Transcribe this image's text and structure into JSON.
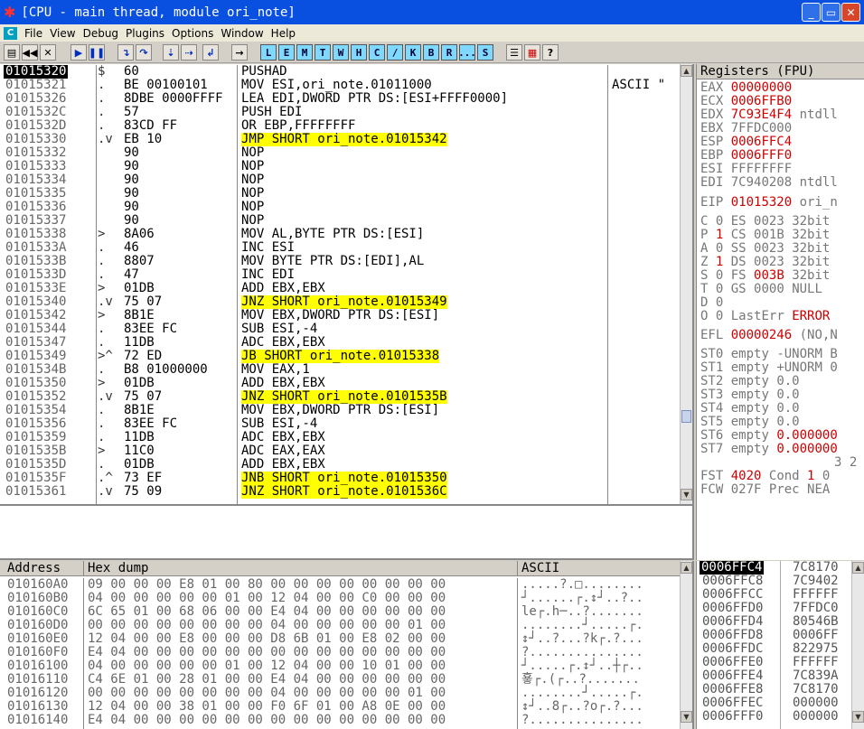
{
  "window": {
    "title": "[CPU - main thread, module ori_note]"
  },
  "menu": [
    "File",
    "View",
    "Debug",
    "Plugins",
    "Options",
    "Window",
    "Help"
  ],
  "toolbar": {
    "letters": [
      "L",
      "E",
      "M",
      "T",
      "W",
      "H",
      "C",
      "/",
      "K",
      "B",
      "R",
      "...",
      "S"
    ]
  },
  "disasm": {
    "rows": [
      {
        "addr": "01015320",
        "mark": "$",
        "hex": "60",
        "instr": "PUSHAD",
        "comment": "",
        "sel": true,
        "hl": false
      },
      {
        "addr": "01015321",
        "mark": ".",
        "hex": "BE 00100101",
        "instr": "MOV ESI,ori_note.01011000",
        "comment": "ASCII \"",
        "sel": false,
        "hl": false
      },
      {
        "addr": "01015326",
        "mark": ".",
        "hex": "8DBE 0000FFFF",
        "instr": "LEA EDI,DWORD PTR DS:[ESI+FFFF0000]",
        "comment": "",
        "sel": false,
        "hl": false
      },
      {
        "addr": "0101532C",
        "mark": ".",
        "hex": "57",
        "instr": "PUSH EDI",
        "comment": "",
        "sel": false,
        "hl": false
      },
      {
        "addr": "0101532D",
        "mark": ".",
        "hex": "83CD FF",
        "instr": "OR EBP,FFFFFFFF",
        "comment": "",
        "sel": false,
        "hl": false
      },
      {
        "addr": "01015330",
        "mark": ".v",
        "hex": "EB 10",
        "instr": "JMP SHORT ori_note.01015342",
        "comment": "",
        "sel": false,
        "hl": true
      },
      {
        "addr": "01015332",
        "mark": "",
        "hex": "90",
        "instr": "NOP",
        "comment": "",
        "sel": false,
        "hl": false
      },
      {
        "addr": "01015333",
        "mark": "",
        "hex": "90",
        "instr": "NOP",
        "comment": "",
        "sel": false,
        "hl": false
      },
      {
        "addr": "01015334",
        "mark": "",
        "hex": "90",
        "instr": "NOP",
        "comment": "",
        "sel": false,
        "hl": false
      },
      {
        "addr": "01015335",
        "mark": "",
        "hex": "90",
        "instr": "NOP",
        "comment": "",
        "sel": false,
        "hl": false
      },
      {
        "addr": "01015336",
        "mark": "",
        "hex": "90",
        "instr": "NOP",
        "comment": "",
        "sel": false,
        "hl": false
      },
      {
        "addr": "01015337",
        "mark": "",
        "hex": "90",
        "instr": "NOP",
        "comment": "",
        "sel": false,
        "hl": false
      },
      {
        "addr": "01015338",
        "mark": ">",
        "hex": "8A06",
        "instr": "MOV AL,BYTE PTR DS:[ESI]",
        "comment": "",
        "sel": false,
        "hl": false
      },
      {
        "addr": "0101533A",
        "mark": ".",
        "hex": "46",
        "instr": "INC ESI",
        "comment": "",
        "sel": false,
        "hl": false
      },
      {
        "addr": "0101533B",
        "mark": ".",
        "hex": "8807",
        "instr": "MOV BYTE PTR DS:[EDI],AL",
        "comment": "",
        "sel": false,
        "hl": false
      },
      {
        "addr": "0101533D",
        "mark": ".",
        "hex": "47",
        "instr": "INC EDI",
        "comment": "",
        "sel": false,
        "hl": false
      },
      {
        "addr": "0101533E",
        "mark": ">",
        "hex": "01DB",
        "instr": "ADD EBX,EBX",
        "comment": "",
        "sel": false,
        "hl": false
      },
      {
        "addr": "01015340",
        "mark": ".v",
        "hex": "75 07",
        "instr": "JNZ SHORT ori_note.01015349",
        "comment": "",
        "sel": false,
        "hl": true
      },
      {
        "addr": "01015342",
        "mark": ">",
        "hex": "8B1E",
        "instr": "MOV EBX,DWORD PTR DS:[ESI]",
        "comment": "",
        "sel": false,
        "hl": false
      },
      {
        "addr": "01015344",
        "mark": ".",
        "hex": "83EE FC",
        "instr": "SUB ESI,-4",
        "comment": "",
        "sel": false,
        "hl": false
      },
      {
        "addr": "01015347",
        "mark": ".",
        "hex": "11DB",
        "instr": "ADC EBX,EBX",
        "comment": "",
        "sel": false,
        "hl": false
      },
      {
        "addr": "01015349",
        "mark": ">^",
        "hex": "72 ED",
        "instr": "JB SHORT ori_note.01015338",
        "comment": "",
        "sel": false,
        "hl": true
      },
      {
        "addr": "0101534B",
        "mark": ".",
        "hex": "B8 01000000",
        "instr": "MOV EAX,1",
        "comment": "",
        "sel": false,
        "hl": false
      },
      {
        "addr": "01015350",
        "mark": ">",
        "hex": "01DB",
        "instr": "ADD EBX,EBX",
        "comment": "",
        "sel": false,
        "hl": false
      },
      {
        "addr": "01015352",
        "mark": ".v",
        "hex": "75 07",
        "instr": "JNZ SHORT ori_note.0101535B",
        "comment": "",
        "sel": false,
        "hl": true
      },
      {
        "addr": "01015354",
        "mark": ".",
        "hex": "8B1E",
        "instr": "MOV EBX,DWORD PTR DS:[ESI]",
        "comment": "",
        "sel": false,
        "hl": false
      },
      {
        "addr": "01015356",
        "mark": ".",
        "hex": "83EE FC",
        "instr": "SUB ESI,-4",
        "comment": "",
        "sel": false,
        "hl": false
      },
      {
        "addr": "01015359",
        "mark": ".",
        "hex": "11DB",
        "instr": "ADC EBX,EBX",
        "comment": "",
        "sel": false,
        "hl": false
      },
      {
        "addr": "0101535B",
        "mark": ">",
        "hex": "11C0",
        "instr": "ADC EAX,EAX",
        "comment": "",
        "sel": false,
        "hl": false
      },
      {
        "addr": "0101535D",
        "mark": ".",
        "hex": "01DB",
        "instr": "ADD EBX,EBX",
        "comment": "",
        "sel": false,
        "hl": false
      },
      {
        "addr": "0101535F",
        "mark": ".^",
        "hex": "73 EF",
        "instr": "JNB SHORT ori_note.01015350",
        "comment": "",
        "sel": false,
        "hl": true
      },
      {
        "addr": "01015361",
        "mark": ".v",
        "hex": "75 09",
        "instr": "JNZ SHORT ori_note.0101536C",
        "comment": "",
        "sel": false,
        "hl": true
      }
    ]
  },
  "registers": {
    "header": "Registers (FPU)",
    "lines": [
      {
        "name": "EAX",
        "value": "00000000",
        "extra": "",
        "red": true
      },
      {
        "name": "ECX",
        "value": "0006FFB0",
        "extra": "",
        "red": true
      },
      {
        "name": "EDX",
        "value": "7C93E4F4",
        "extra": "ntdll",
        "red": true
      },
      {
        "name": "EBX",
        "value": "7FFDC000",
        "extra": "",
        "red": false
      },
      {
        "name": "ESP",
        "value": "0006FFC4",
        "extra": "",
        "red": true
      },
      {
        "name": "EBP",
        "value": "0006FFF0",
        "extra": "",
        "red": true
      },
      {
        "name": "ESI",
        "value": "FFFFFFFF",
        "extra": "",
        "red": false
      },
      {
        "name": "EDI",
        "value": "7C940208",
        "extra": "ntdll",
        "red": false
      },
      {
        "name": "",
        "value": "",
        "extra": "",
        "red": false
      },
      {
        "name": "EIP",
        "value": "01015320",
        "extra": "ori_n",
        "red": true
      }
    ],
    "flags": [
      {
        "f": "C",
        "v": "0",
        "seg": "ES",
        "sv": "0023",
        "tail": "32bit"
      },
      {
        "f": "P",
        "v": "1",
        "seg": "CS",
        "sv": "001B",
        "tail": "32bit"
      },
      {
        "f": "A",
        "v": "0",
        "seg": "SS",
        "sv": "0023",
        "tail": "32bit"
      },
      {
        "f": "Z",
        "v": "1",
        "seg": "DS",
        "sv": "0023",
        "tail": "32bit"
      },
      {
        "f": "S",
        "v": "0",
        "seg": "FS",
        "sv": "003B",
        "tail": "32bit"
      },
      {
        "f": "T",
        "v": "0",
        "seg": "GS",
        "sv": "0000",
        "tail": "NULL"
      },
      {
        "f": "D",
        "v": "0",
        "seg": "",
        "sv": "",
        "tail": ""
      },
      {
        "f": "O",
        "v": "0",
        "seg": "LastErr",
        "sv": "",
        "tail": "ERROR"
      }
    ],
    "efl": {
      "name": "EFL",
      "value": "00000246",
      "extra": "(NO,N"
    },
    "fpu": [
      {
        "name": "ST0",
        "state": "empty",
        "val": "-UNORM B"
      },
      {
        "name": "ST1",
        "state": "empty",
        "val": "+UNORM 0"
      },
      {
        "name": "ST2",
        "state": "empty",
        "val": "0.0"
      },
      {
        "name": "ST3",
        "state": "empty",
        "val": "0.0"
      },
      {
        "name": "ST4",
        "state": "empty",
        "val": "0.0"
      },
      {
        "name": "ST5",
        "state": "empty",
        "val": "0.0"
      },
      {
        "name": "ST6",
        "state": "empty",
        "val": "0.000000"
      },
      {
        "name": "ST7",
        "state": "empty",
        "val": "0.000000"
      }
    ],
    "bits_line": "3 2",
    "fst": {
      "name": "FST",
      "value": "4020",
      "mid": "Cond",
      "c1": "1",
      "c2": "0"
    },
    "fcw": {
      "name": "FCW",
      "value": "027F",
      "mid": "Prec",
      "tail": "NEA"
    }
  },
  "dump": {
    "col_address": "Address",
    "col_hex": "Hex dump",
    "col_ascii": "ASCII",
    "rows": [
      {
        "addr": "010160A0",
        "hex": "09 00 00 00 E8 01 00 80 00 00 00 00 00 00 00 00",
        "ascii": ".....?.□........"
      },
      {
        "addr": "010160B0",
        "hex": "04 00 00 00 00 00 01 00 12 04 00 00 C0 00 00 00",
        "ascii": "┘......┌.↕┘..?.."
      },
      {
        "addr": "010160C0",
        "hex": "6C 65 01 00 68 06 00 00 E4 04 00 00 00 00 00 00",
        "ascii": "le┌.h─..?......."
      },
      {
        "addr": "010160D0",
        "hex": "00 00 00 00 00 00 00 00 04 00 00 00 00 00 01 00",
        "ascii": "........┘.....┌."
      },
      {
        "addr": "010160E0",
        "hex": "12 04 00 00 E8 00 00 00 D8 6B 01 00 E8 02 00 00",
        "ascii": "↕┘..?...?k┌.?..."
      },
      {
        "addr": "010160F0",
        "hex": "E4 04 00 00 00 00 00 00 00 00 00 00 00 00 00 00",
        "ascii": "?..............."
      },
      {
        "addr": "01016100",
        "hex": "04 00 00 00 00 00 01 00 12 04 00 00 10 01 00 00",
        "ascii": "┘.....┌.↕┘..┼┌.."
      },
      {
        "addr": "01016110",
        "hex": "C4 6E 01 00 28 01 00 00 E4 04 00 00 00 00 00 00",
        "ascii": "훃┌.(┌..?......."
      },
      {
        "addr": "01016120",
        "hex": "00 00 00 00 00 00 00 00 04 00 00 00 00 00 01 00",
        "ascii": "........┘.....┌."
      },
      {
        "addr": "01016130",
        "hex": "12 04 00 00 38 01 00 00 F0 6F 01 00 A8 0E 00 00",
        "ascii": "↕┘..8┌..?o┌.?..."
      },
      {
        "addr": "01016140",
        "hex": "E4 04 00 00 00 00 00 00 00 00 00 00 00 00 00 00",
        "ascii": "?..............."
      }
    ]
  },
  "stack": {
    "rows": [
      {
        "addr": "0006FFC4",
        "val": "7C8170",
        "sel": true
      },
      {
        "addr": "0006FFC8",
        "val": "7C9402",
        "sel": false
      },
      {
        "addr": "0006FFCC",
        "val": "FFFFFF",
        "sel": false
      },
      {
        "addr": "0006FFD0",
        "val": "7FFDC0",
        "sel": false
      },
      {
        "addr": "0006FFD4",
        "val": "80546B",
        "sel": false
      },
      {
        "addr": "0006FFD8",
        "val": "0006FF",
        "sel": false
      },
      {
        "addr": "0006FFDC",
        "val": "822975",
        "sel": false
      },
      {
        "addr": "0006FFE0",
        "val": "FFFFFF",
        "sel": false
      },
      {
        "addr": "0006FFE4",
        "val": "7C839A",
        "sel": false
      },
      {
        "addr": "0006FFE8",
        "val": "7C8170",
        "sel": false
      },
      {
        "addr": "0006FFEC",
        "val": "000000",
        "sel": false
      },
      {
        "addr": "0006FFF0",
        "val": "000000",
        "sel": false
      }
    ]
  }
}
